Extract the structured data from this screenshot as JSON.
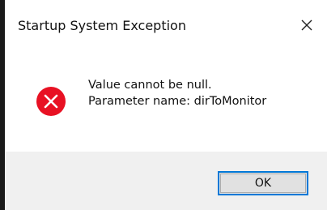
{
  "window": {
    "title": "Startup System Exception",
    "close_icon": "close-icon"
  },
  "message": {
    "icon": "error-icon",
    "icon_color": "#e81123",
    "line1": "Value cannot be null.",
    "line2": "Parameter name: dirToMonitor"
  },
  "buttons": {
    "ok_label": "OK",
    "accent": "#0078d7"
  }
}
